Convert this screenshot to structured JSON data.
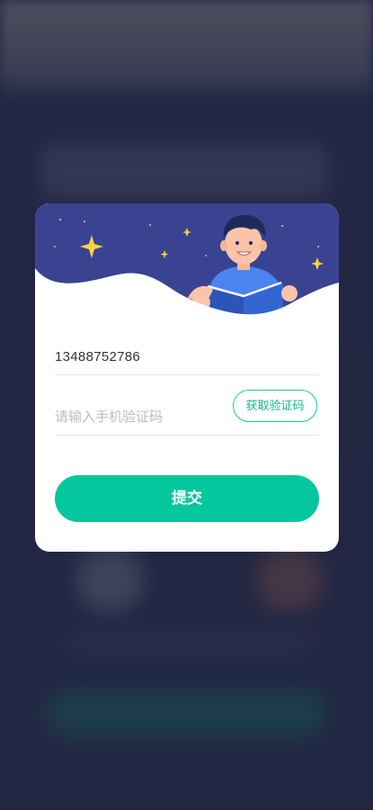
{
  "form": {
    "phone_value": "13488752786",
    "code_placeholder": "请输入手机验证码",
    "get_code_label": "获取验证码",
    "submit_label": "提交"
  },
  "colors": {
    "banner": "#3a4391",
    "accent": "#05c79d",
    "accent_text": "#13b893"
  }
}
